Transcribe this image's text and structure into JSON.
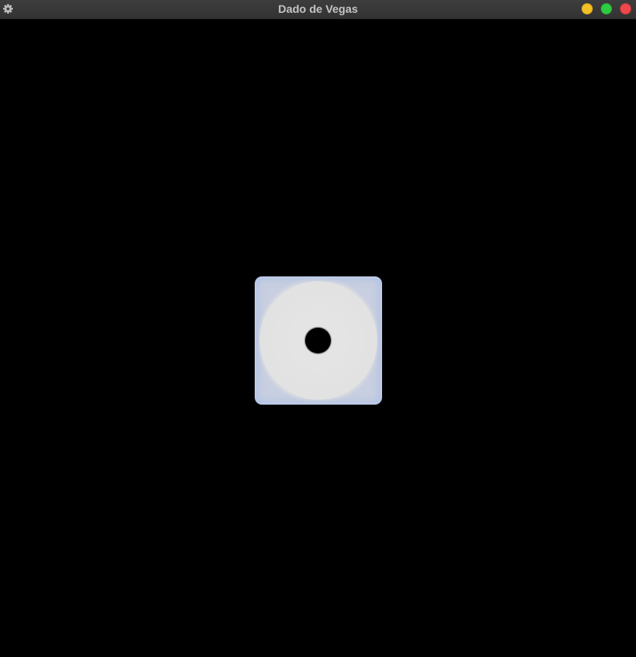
{
  "window": {
    "title": "Dado de Vegas",
    "menu_icon": "gear-icon",
    "controls": [
      {
        "name": "minimize-button",
        "color": "#f4c025"
      },
      {
        "name": "maximize-button",
        "color": "#2ecc40"
      },
      {
        "name": "close-button",
        "color": "#f0474b"
      }
    ]
  },
  "die": {
    "value": 1,
    "face_color": "#e4e4e4",
    "edge_color": "#b8c6e6",
    "pip_color": "#000000"
  },
  "colors": {
    "background": "#000000",
    "titlebar": "#393939",
    "title_text": "#c4c4c4"
  }
}
